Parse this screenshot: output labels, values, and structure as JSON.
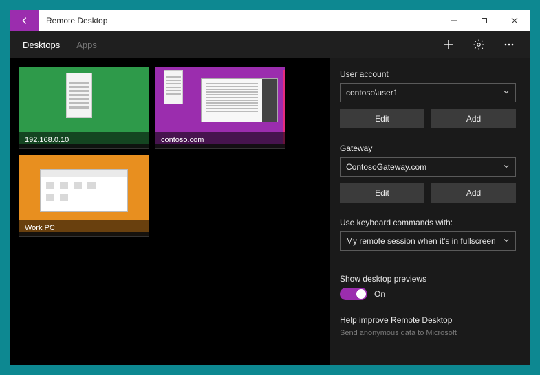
{
  "app": {
    "title": "Remote Desktop"
  },
  "header": {
    "tabs": {
      "desktops": "Desktops",
      "apps": "Apps"
    }
  },
  "desktops": [
    {
      "label": "192.168.0.10"
    },
    {
      "label": "contoso.com"
    },
    {
      "label": "Work PC"
    }
  ],
  "settings": {
    "user_account": {
      "label": "User account",
      "value": "contoso\\user1",
      "edit": "Edit",
      "add": "Add"
    },
    "gateway": {
      "label": "Gateway",
      "value": "ContosoGateway.com",
      "edit": "Edit",
      "add": "Add"
    },
    "keyboard": {
      "label": "Use keyboard commands with:",
      "value": "My remote session when it's in fullscreen"
    },
    "previews": {
      "label": "Show desktop previews",
      "state": "On"
    },
    "telemetry": {
      "label": "Help improve Remote Desktop",
      "sub": "Send anonymous data to Microsoft"
    }
  },
  "colors": {
    "accent": "#9b2dae"
  }
}
